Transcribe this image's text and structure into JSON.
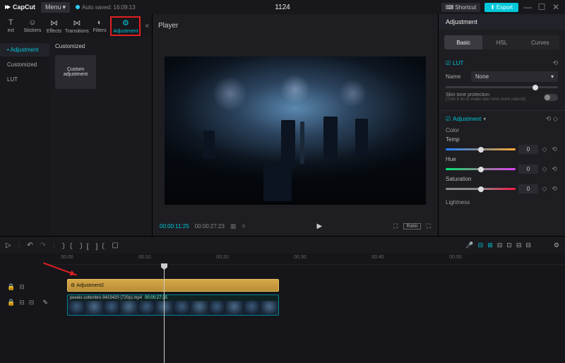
{
  "titlebar": {
    "logo": "CapCut",
    "menu": "Menu",
    "autosave": "Auto saved: 16:09:13",
    "project": "1124",
    "shortcut": "Shortcut",
    "export": "Export"
  },
  "tabs": {
    "text": "ext",
    "stickers": "Stickers",
    "effects": "Effects",
    "transitions": "Transitions",
    "filters": "Filters",
    "adjustment": "Adjustment"
  },
  "sidebar": {
    "items": [
      "Adjustment",
      "Customized",
      "LUT"
    ]
  },
  "custom": {
    "header": "Customized",
    "block": "Custom adjustment"
  },
  "player": {
    "title": "Player",
    "current": "00:00:11:25",
    "duration": "00:00:27:23",
    "ratio": "Ratio"
  },
  "right": {
    "title": "Adjustment",
    "tabs": [
      "Basic",
      "HSL",
      "Curves"
    ],
    "lut": {
      "label": "LUT",
      "name": "Name",
      "value": "None"
    },
    "skin": {
      "label": "Skin tone protection",
      "sub": "(Turn it on to make skin tone more natural)"
    },
    "adjustment": "Adjustment",
    "color": "Color",
    "params": {
      "temp": {
        "label": "Temp",
        "value": "0"
      },
      "hue": {
        "label": "Hue",
        "value": "0"
      },
      "saturation": {
        "label": "Saturation",
        "value": "0"
      }
    },
    "lightness": "Lightness"
  },
  "timeline": {
    "ticks": [
      "00:00",
      "00:10",
      "00:20",
      "00:30",
      "00:40",
      "00:50"
    ],
    "adj_clip": "Adjustment2",
    "vid_clip": "pexels-cottonbro-9419420 (720p).mp4",
    "vid_time": "00:00:27:25"
  }
}
